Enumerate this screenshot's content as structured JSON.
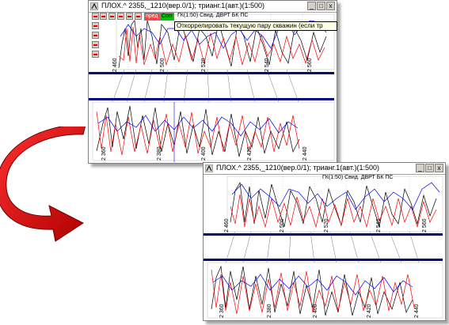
{
  "windows": [
    {
      "title": "ПЛОХ.^ 2355,_1210(вер.0/1); трианг.1(авт.)(1:500)",
      "controls": {
        "minimize": "_",
        "maximize": "□",
        "close": "x"
      }
    },
    {
      "title": "ПЛОХ.^ 2355,_1210(вер.0/1); трианг.1(авт.)(1:500)",
      "controls": {
        "minimize": "_",
        "maximize": "□",
        "close": "x"
      }
    }
  ],
  "toolbar": {
    "tag_left": "пред",
    "tag_corr": "Corr",
    "header_labels": "ГК(1:50) Свид. ДВРТ БК  ПС"
  },
  "tooltip": "Откоррелировать текущую пару скважин (если тр",
  "depth_labels": {
    "top": [
      "2 460",
      "2 500",
      "2 520",
      "2 540",
      "2 560"
    ],
    "bottom": [
      "2 360",
      "2 380",
      "2 400",
      "2 420",
      "2 440"
    ]
  },
  "colors": {
    "curve_black": "#000000",
    "curve_red": "#ff0000",
    "curve_blue": "#0000ff",
    "separator_navy": "#000080",
    "arrow_red": "#e00000"
  }
}
